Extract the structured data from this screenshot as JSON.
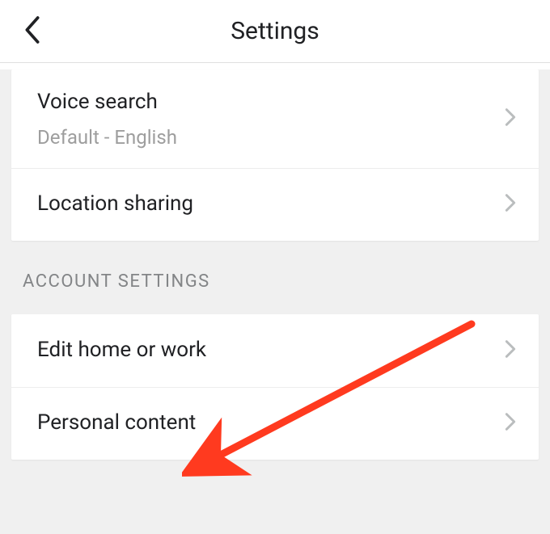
{
  "header": {
    "title": "Settings"
  },
  "group1": {
    "voice_search": {
      "title": "Voice search",
      "subtitle": "Default - English"
    },
    "location_sharing": {
      "title": "Location sharing"
    }
  },
  "section2_header": "ACCOUNT SETTINGS",
  "group2": {
    "edit_home_work": {
      "title": "Edit home or work"
    },
    "personal_content": {
      "title": "Personal content"
    }
  }
}
